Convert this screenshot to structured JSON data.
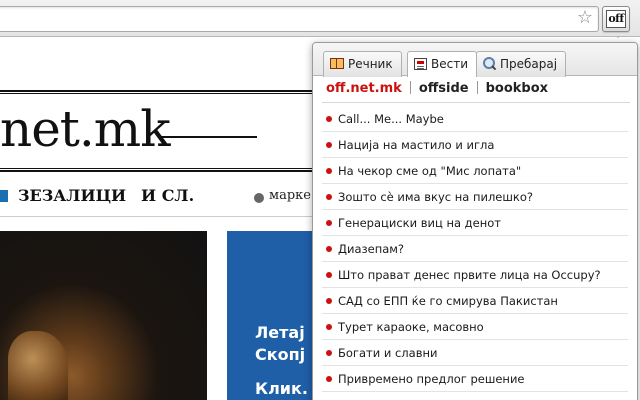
{
  "browser": {
    "bookmark_icon": "star-icon",
    "extension_button_label": "off"
  },
  "page": {
    "logo_text": "net.mk",
    "nav": {
      "item1": "ЗЕЗАЛИЦИ",
      "item2": "И СЛ.",
      "marker": "марке"
    },
    "promo": {
      "line1": "Летај",
      "line2": "Скопј",
      "line3": "Клик."
    }
  },
  "popup": {
    "tabs": [
      {
        "label": "Речник",
        "icon": "book-icon",
        "active": false
      },
      {
        "label": "Вести",
        "icon": "news-icon",
        "active": true
      },
      {
        "label": "Пребарај",
        "icon": "search-icon",
        "active": false
      }
    ],
    "sources": [
      {
        "label": "off.net.mk",
        "active": true
      },
      {
        "label": "offside",
        "active": false
      },
      {
        "label": "bookbox",
        "active": false
      }
    ],
    "news": [
      "Call... Me... Maybe",
      "Нација на мастило и игла",
      "На чекор сме од \"Мис лопата\"",
      "Зошто сè има вкус на пилешко?",
      "Генерациски виц на денот",
      "Диазепам?",
      "Што прават денес првите лица на Occupy?",
      "САД со ЕПП ќе го смирува Пакистан",
      "Турет караоке, масовно",
      "Богати и славни",
      "Привремено предлог решение"
    ],
    "colors": {
      "accent": "#cc1111",
      "bullet": "#cc1111"
    }
  }
}
